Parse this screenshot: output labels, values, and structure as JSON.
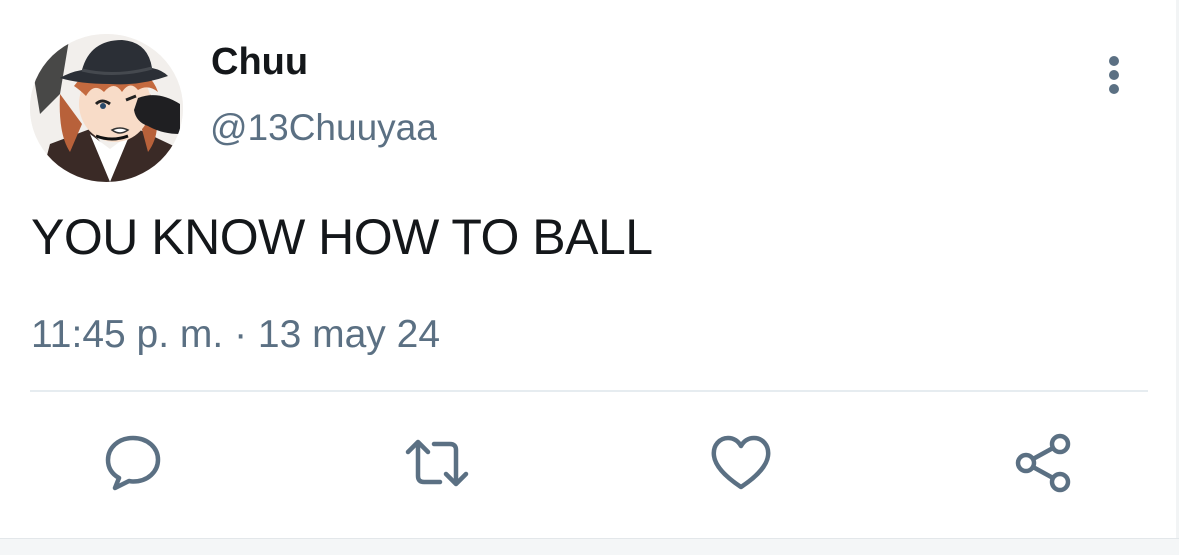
{
  "tweet": {
    "author": {
      "display_name": "Chuu",
      "handle": "@13Chuuyaa",
      "avatar_icon": "anime-avatar"
    },
    "text": "YOU KNOW HOW TO BALL",
    "time": "11:45 p. m.",
    "separator": " · ",
    "date": "13 may 24",
    "actions": [
      {
        "name": "reply",
        "icon": "speech-bubble-icon"
      },
      {
        "name": "retweet",
        "icon": "retweet-arrows-icon"
      },
      {
        "name": "like",
        "icon": "heart-icon"
      },
      {
        "name": "share",
        "icon": "share-nodes-icon"
      }
    ]
  },
  "colors": {
    "text_primary": "#14171a",
    "text_secondary": "#5b7083",
    "divider": "#e6ecf0",
    "background": "#ffffff"
  }
}
